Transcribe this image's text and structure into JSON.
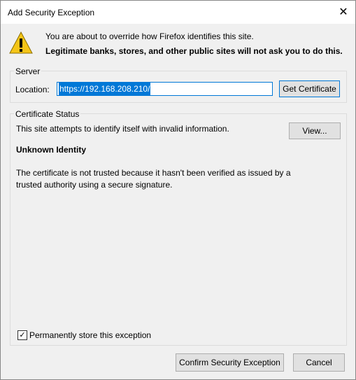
{
  "window": {
    "title": "Add Security Exception",
    "close_glyph": "✕"
  },
  "warning": {
    "icon": "warning-triangle-icon",
    "line1": "You are about to override how Firefox identifies this site.",
    "line2": "Legitimate banks, stores, and other public sites will not ask you to do this."
  },
  "server": {
    "group_label": "Server",
    "location_label": "Location:",
    "location_value": "https://192.168.208.210/",
    "get_certificate_label": "Get Certificate"
  },
  "status": {
    "group_label": "Certificate Status",
    "text": "This site attempts to identify itself with invalid information.",
    "view_label": "View...",
    "identity_heading": "Unknown Identity",
    "description": "The certificate is not trusted because it hasn't been verified as issued by a trusted authority using a secure signature."
  },
  "options": {
    "permanent_label": "Permanently store this exception",
    "permanent_checked": true
  },
  "buttons": {
    "confirm_label": "Confirm Security Exception",
    "cancel_label": "Cancel"
  }
}
